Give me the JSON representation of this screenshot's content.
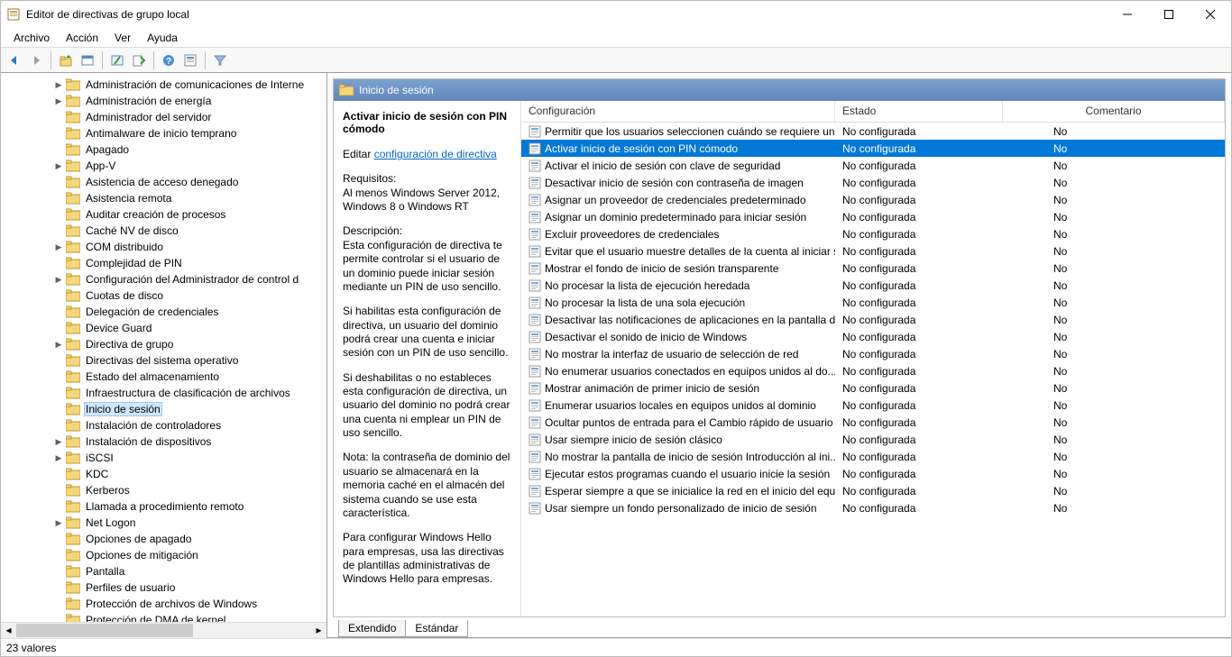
{
  "title": "Editor de directivas de grupo local",
  "menu": [
    "Archivo",
    "Acción",
    "Ver",
    "Ayuda"
  ],
  "tree": [
    {
      "label": "Administración de comunicaciones de Interne",
      "level": 3,
      "expand": ">"
    },
    {
      "label": "Administración de energía",
      "level": 3,
      "expand": ">"
    },
    {
      "label": "Administrador del servidor",
      "level": 3,
      "expand": ""
    },
    {
      "label": "Antimalware de inicio temprano",
      "level": 3,
      "expand": ""
    },
    {
      "label": "Apagado",
      "level": 3,
      "expand": ""
    },
    {
      "label": "App-V",
      "level": 3,
      "expand": ">"
    },
    {
      "label": "Asistencia de acceso denegado",
      "level": 3,
      "expand": ""
    },
    {
      "label": "Asistencia remota",
      "level": 3,
      "expand": ""
    },
    {
      "label": "Auditar creación de procesos",
      "level": 3,
      "expand": ""
    },
    {
      "label": "Caché NV de disco",
      "level": 3,
      "expand": ""
    },
    {
      "label": "COM distribuido",
      "level": 3,
      "expand": ">"
    },
    {
      "label": "Complejidad de PIN",
      "level": 3,
      "expand": ""
    },
    {
      "label": "Configuración del Administrador de control d",
      "level": 3,
      "expand": ">"
    },
    {
      "label": "Cuotas de disco",
      "level": 3,
      "expand": ""
    },
    {
      "label": "Delegación de credenciales",
      "level": 3,
      "expand": ""
    },
    {
      "label": "Device Guard",
      "level": 3,
      "expand": ""
    },
    {
      "label": "Directiva de grupo",
      "level": 3,
      "expand": ">"
    },
    {
      "label": "Directivas del sistema operativo",
      "level": 3,
      "expand": ""
    },
    {
      "label": "Estado del almacenamiento",
      "level": 3,
      "expand": ""
    },
    {
      "label": "Infraestructura de clasificación de archivos",
      "level": 3,
      "expand": ""
    },
    {
      "label": "Inicio de sesión",
      "level": 3,
      "expand": "",
      "selected": true
    },
    {
      "label": "Instalación de controladores",
      "level": 3,
      "expand": ""
    },
    {
      "label": "Instalación de dispositivos",
      "level": 3,
      "expand": ">"
    },
    {
      "label": "iSCSI",
      "level": 3,
      "expand": ">"
    },
    {
      "label": "KDC",
      "level": 3,
      "expand": ""
    },
    {
      "label": "Kerberos",
      "level": 3,
      "expand": ""
    },
    {
      "label": "Llamada a procedimiento remoto",
      "level": 3,
      "expand": ""
    },
    {
      "label": "Net Logon",
      "level": 3,
      "expand": ">"
    },
    {
      "label": "Opciones de apagado",
      "level": 3,
      "expand": ""
    },
    {
      "label": "Opciones de mitigación",
      "level": 3,
      "expand": ""
    },
    {
      "label": "Pantalla",
      "level": 3,
      "expand": ""
    },
    {
      "label": "Perfiles de usuario",
      "level": 3,
      "expand": ""
    },
    {
      "label": "Protección de archivos de Windows",
      "level": 3,
      "expand": ""
    },
    {
      "label": "Protección de DMA de kernel",
      "level": 3,
      "expand": ""
    }
  ],
  "panel_title": "Inicio de sesión",
  "detail": {
    "title": "Activar inicio de sesión con PIN cómodo",
    "edit_prefix": "Editar",
    "edit_link": "configuración de directiva",
    "req_h": "Requisitos:",
    "req_body": "Al menos Windows Server 2012, Windows 8 o Windows RT",
    "desc_h": "Descripción:",
    "desc_1": "Esta configuración de directiva te permite controlar si el usuario de un dominio puede iniciar sesión mediante un PIN de uso sencillo.",
    "desc_2": "Si habilitas esta configuración de directiva, un usuario del dominio podrá crear una cuenta e iniciar sesión con un PIN de uso sencillo.",
    "desc_3": "Si deshabilitas o no estableces esta configuración de directiva, un usuario del dominio no podrá crear una cuenta ni emplear un PIN de uso sencillo.",
    "desc_4": "Nota: la contraseña de dominio del usuario se almacenará en la memoria caché en el almacén del sistema cuando se use esta característica.",
    "desc_5": "Para configurar Windows Hello para empresas, usa las directivas de plantillas administrativas de Windows Hello para empresas."
  },
  "columns": {
    "c1": "Configuración",
    "c2": "Estado",
    "c3": "Comentario"
  },
  "settings": [
    {
      "name": "Permitir que los usuarios seleccionen cuándo se requiere un...",
      "state": "No configurada",
      "comment": "No"
    },
    {
      "name": "Activar inicio de sesión con PIN cómodo",
      "state": "No configurada",
      "comment": "No",
      "selected": true
    },
    {
      "name": "Activar el inicio de sesión con clave de seguridad",
      "state": "No configurada",
      "comment": "No"
    },
    {
      "name": "Desactivar inicio de sesión con contraseña de imagen",
      "state": "No configurada",
      "comment": "No"
    },
    {
      "name": "Asignar un proveedor de credenciales predeterminado",
      "state": "No configurada",
      "comment": "No"
    },
    {
      "name": "Asignar un dominio predeterminado para iniciar sesión",
      "state": "No configurada",
      "comment": "No"
    },
    {
      "name": "Excluir proveedores de credenciales",
      "state": "No configurada",
      "comment": "No"
    },
    {
      "name": "Evitar que el usuario muestre detalles de la cuenta al iniciar s...",
      "state": "No configurada",
      "comment": "No"
    },
    {
      "name": "Mostrar el fondo de inicio de sesión transparente",
      "state": "No configurada",
      "comment": "No"
    },
    {
      "name": "No procesar la lista de ejecución heredada",
      "state": "No configurada",
      "comment": "No"
    },
    {
      "name": "No procesar la lista de una sola ejecución",
      "state": "No configurada",
      "comment": "No"
    },
    {
      "name": "Desactivar las notificaciones de aplicaciones en la pantalla d...",
      "state": "No configurada",
      "comment": "No"
    },
    {
      "name": "Desactivar el sonido de inicio de Windows",
      "state": "No configurada",
      "comment": "No"
    },
    {
      "name": "No mostrar la interfaz de usuario de selección de red",
      "state": "No configurada",
      "comment": "No"
    },
    {
      "name": "No enumerar usuarios conectados en equipos unidos al do...",
      "state": "No configurada",
      "comment": "No"
    },
    {
      "name": "Mostrar animación de primer inicio de sesión",
      "state": "No configurada",
      "comment": "No"
    },
    {
      "name": "Enumerar usuarios locales en equipos unidos al dominio",
      "state": "No configurada",
      "comment": "No"
    },
    {
      "name": "Ocultar puntos de entrada para el Cambio rápido de usuario",
      "state": "No configurada",
      "comment": "No"
    },
    {
      "name": "Usar siempre inicio de sesión clásico",
      "state": "No configurada",
      "comment": "No"
    },
    {
      "name": "No mostrar la pantalla de inicio de sesión Introducción al ini...",
      "state": "No configurada",
      "comment": "No"
    },
    {
      "name": "Ejecutar estos programas cuando el usuario inicie la sesión",
      "state": "No configurada",
      "comment": "No"
    },
    {
      "name": "Esperar siempre a que se inicialice la red en el inicio del equi...",
      "state": "No configurada",
      "comment": "No"
    },
    {
      "name": "Usar siempre un fondo personalizado de inicio de sesión",
      "state": "No configurada",
      "comment": "No"
    }
  ],
  "tabs": {
    "extended": "Extendido",
    "standard": "Estándar"
  },
  "status": "23 valores"
}
